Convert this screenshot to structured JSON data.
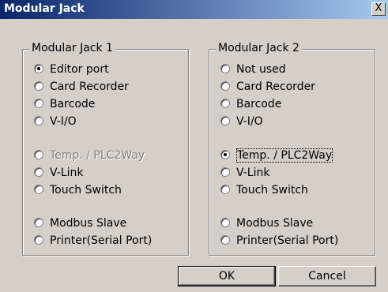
{
  "window": {
    "title": "Modular Jack",
    "close_glyph": "X"
  },
  "group1": {
    "legend": "Modular Jack 1",
    "options": [
      {
        "label": "Editor port",
        "checked": true,
        "disabled": false
      },
      {
        "label": "Card Recorder",
        "checked": false,
        "disabled": false
      },
      {
        "label": "Barcode",
        "checked": false,
        "disabled": false
      },
      {
        "label": "V-I/O",
        "checked": false,
        "disabled": false
      },
      {
        "label": "Temp. / PLC2Way",
        "checked": false,
        "disabled": true
      },
      {
        "label": "V-Link",
        "checked": false,
        "disabled": false
      },
      {
        "label": "Touch Switch",
        "checked": false,
        "disabled": false
      },
      {
        "label": "Modbus Slave",
        "checked": false,
        "disabled": false
      },
      {
        "label": "Printer(Serial Port)",
        "checked": false,
        "disabled": false
      }
    ]
  },
  "group2": {
    "legend": "Modular Jack 2",
    "options": [
      {
        "label": "Not used",
        "checked": false,
        "disabled": false
      },
      {
        "label": "Card Recorder",
        "checked": false,
        "disabled": false
      },
      {
        "label": "Barcode",
        "checked": false,
        "disabled": false
      },
      {
        "label": "V-I/O",
        "checked": false,
        "disabled": false
      },
      {
        "label": "Temp. / PLC2Way",
        "checked": true,
        "disabled": false,
        "focused": true
      },
      {
        "label": "V-Link",
        "checked": false,
        "disabled": false
      },
      {
        "label": "Touch Switch",
        "checked": false,
        "disabled": false
      },
      {
        "label": "Modbus Slave",
        "checked": false,
        "disabled": false
      },
      {
        "label": "Printer(Serial Port)",
        "checked": false,
        "disabled": false
      }
    ]
  },
  "buttons": {
    "ok": "OK",
    "cancel": "Cancel"
  }
}
